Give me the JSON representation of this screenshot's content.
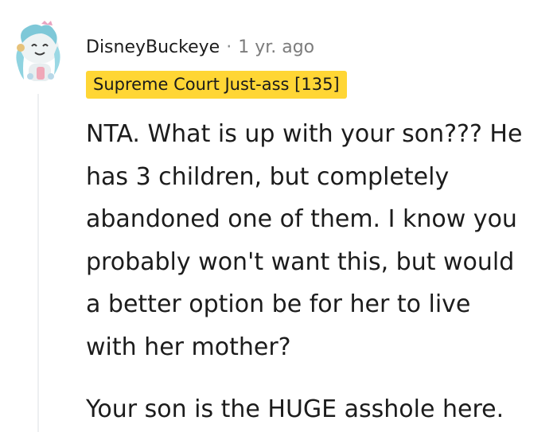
{
  "comment": {
    "username": "DisneyBuckeye",
    "separator": "·",
    "timestamp": "1 yr. ago",
    "flair": {
      "text": "Supreme Court Just-ass [135]",
      "background": "#ffd635"
    },
    "avatar": {
      "icon": "snoo-avatar-icon"
    },
    "paragraphs": [
      "NTA. What is up with your son??? He\nhas 3 children, but completely\nabandoned one of them. I know you\nprobably won't want this, but would\na better option be for her to live\nwith her mother?",
      "Your son is the HUGE asshole here."
    ]
  }
}
